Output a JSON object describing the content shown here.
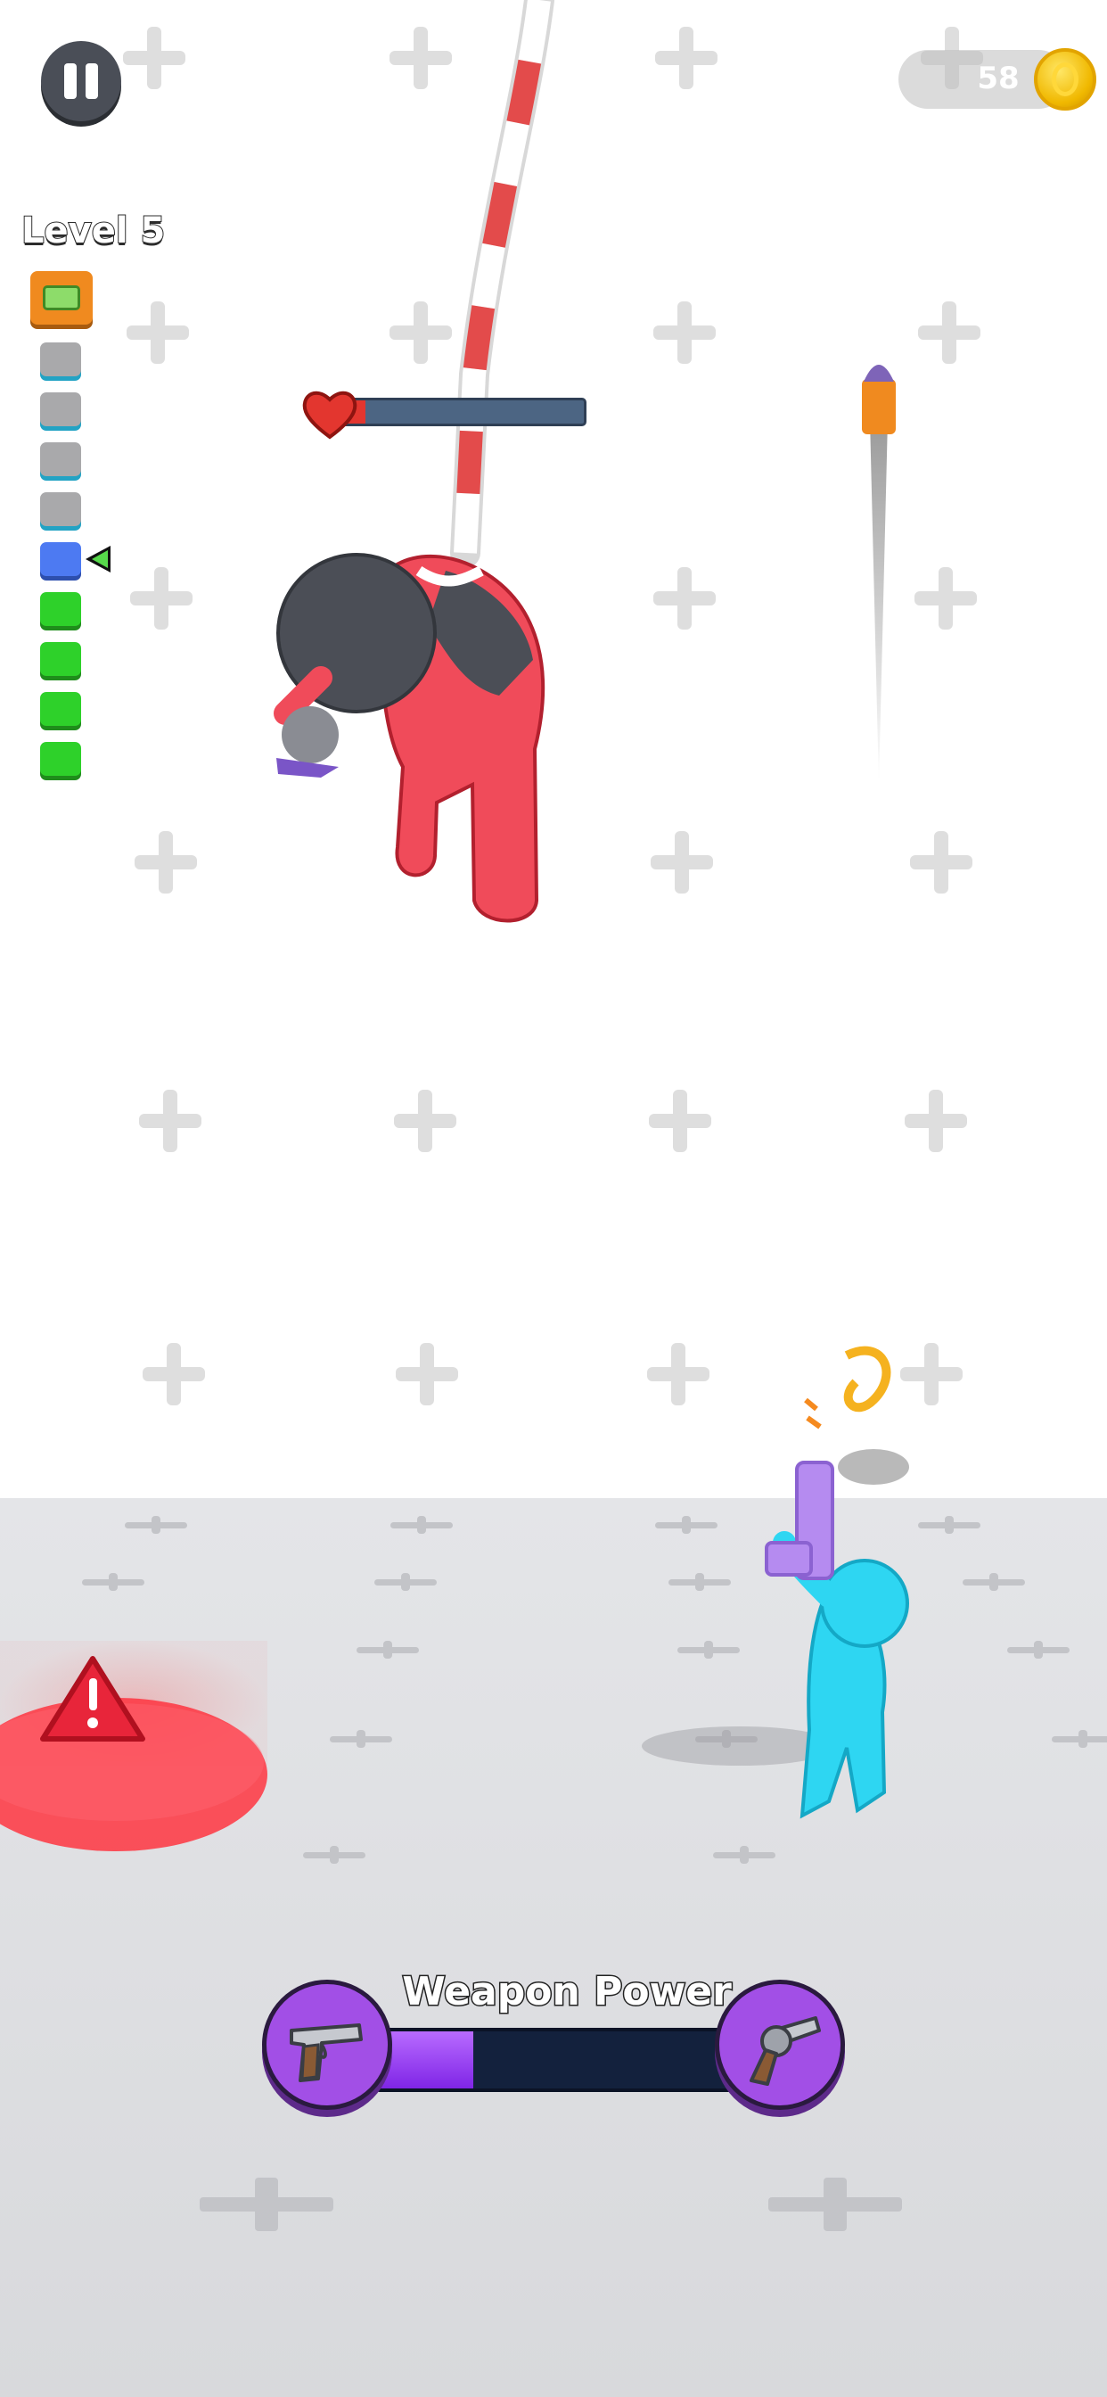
{
  "hud": {
    "coin_count": "58",
    "level_label": "Level 5",
    "level_progress": {
      "stages": [
        "reward",
        "done",
        "done",
        "done",
        "done",
        "current",
        "next",
        "next",
        "next",
        "next"
      ],
      "current_index": 5
    },
    "enemy_health_fraction": 0.1,
    "weapon_power": {
      "title": "Weapon Power",
      "fraction": 0.26,
      "current_weapon": "pistol-icon",
      "next_weapon": "revolver-icon"
    }
  },
  "colors": {
    "enemy": "#f04b5a",
    "player": "#2ed6f2",
    "warning": "#e8253a",
    "power_fill": "#8b32ea",
    "coin": "#f5c400"
  }
}
